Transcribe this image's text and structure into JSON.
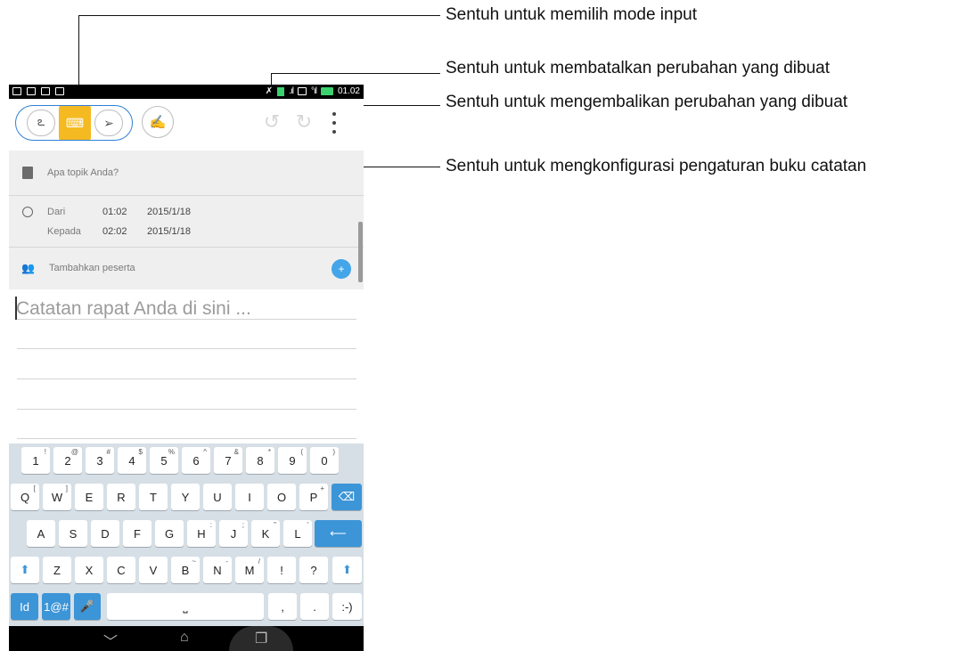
{
  "callouts": {
    "mode_input": "Sentuh untuk memilih mode input",
    "undo": "Sentuh untuk membatalkan perubahan yang dibuat",
    "redo": "Sentuh untuk mengembalikan perubahan yang dibuat",
    "settings": "Sentuh untuk mengkonfigurasi pengaturan buku catatan"
  },
  "status_bar": {
    "time": "01.02"
  },
  "form": {
    "topic_placeholder": "Apa topik Anda?",
    "from_label": "Dari",
    "from_time": "01:02",
    "from_date": "2015/1/18",
    "to_label": "Kepada",
    "to_time": "02:02",
    "to_date": "2015/1/18",
    "participants_placeholder": "Tambahkan peserta"
  },
  "notes": {
    "placeholder": "Catatan rapat Anda di sini ..."
  },
  "keyboard": {
    "row1": [
      {
        "k": "1",
        "s": "!"
      },
      {
        "k": "2",
        "s": "@"
      },
      {
        "k": "3",
        "s": "#"
      },
      {
        "k": "4",
        "s": "$"
      },
      {
        "k": "5",
        "s": "%"
      },
      {
        "k": "6",
        "s": "^"
      },
      {
        "k": "7",
        "s": "&"
      },
      {
        "k": "8",
        "s": "*"
      },
      {
        "k": "9",
        "s": "("
      },
      {
        "k": "0",
        "s": ")"
      }
    ],
    "row2": [
      {
        "k": "Q",
        "s": "["
      },
      {
        "k": "W",
        "s": "]"
      },
      {
        "k": "E",
        "s": ""
      },
      {
        "k": "R",
        "s": ""
      },
      {
        "k": "T",
        "s": ""
      },
      {
        "k": "Y",
        "s": ""
      },
      {
        "k": "U",
        "s": ""
      },
      {
        "k": "I",
        "s": ""
      },
      {
        "k": "O",
        "s": ""
      },
      {
        "k": "P",
        "s": "+"
      }
    ],
    "row3": [
      {
        "k": "A",
        "s": ""
      },
      {
        "k": "S",
        "s": ""
      },
      {
        "k": "D",
        "s": ""
      },
      {
        "k": "F",
        "s": ""
      },
      {
        "k": "G",
        "s": ""
      },
      {
        "k": "H",
        "s": ":"
      },
      {
        "k": "J",
        "s": ";"
      },
      {
        "k": "K",
        "s": "\""
      },
      {
        "k": "L",
        "s": "'"
      }
    ],
    "row4": [
      {
        "k": "Z",
        "s": ""
      },
      {
        "k": "X",
        "s": ""
      },
      {
        "k": "C",
        "s": ""
      },
      {
        "k": "V",
        "s": ""
      },
      {
        "k": "B",
        "s": "~"
      },
      {
        "k": "N",
        "s": "-"
      },
      {
        "k": "M",
        "s": "/"
      },
      {
        "k": "!",
        "s": ""
      },
      {
        "k": "?",
        "s": ""
      }
    ],
    "row5": {
      "lang": "Id",
      "symbols": "1@#",
      "comma": ",",
      "period": ".",
      "emoji": ":-)"
    }
  },
  "icons": {
    "accent_blue": "#2f7fd6",
    "active_mode": "#f5b921",
    "key_blue": "#3c95d7"
  }
}
